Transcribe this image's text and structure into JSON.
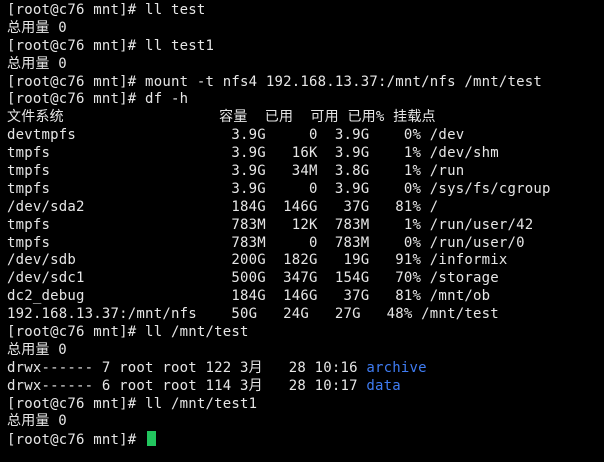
{
  "colors": {
    "background": "#000000",
    "text": "#e6e6e6",
    "directory": "#3f7cf3",
    "cursor": "#22c55e"
  },
  "terminal": {
    "lines": [
      "[root@c76 mnt]# ll test",
      "总用量 0",
      "[root@c76 mnt]# ll test1",
      "总用量 0",
      "[root@c76 mnt]# mount -t nfs4 192.168.13.37:/mnt/nfs /mnt/test",
      "[root@c76 mnt]# df -h",
      "文件系统                  容量  已用  可用 已用% 挂载点",
      "devtmpfs                  3.9G     0  3.9G    0% /dev",
      "tmpfs                     3.9G   16K  3.9G    1% /dev/shm",
      "tmpfs                     3.9G   34M  3.8G    1% /run",
      "tmpfs                     3.9G     0  3.9G    0% /sys/fs/cgroup",
      "/dev/sda2                 184G  146G   37G   81% /",
      "tmpfs                     783M   12K  783M    1% /run/user/42",
      "tmpfs                     783M     0  783M    0% /run/user/0",
      "/dev/sdb                  200G  182G   19G   91% /informix",
      "/dev/sdc1                 500G  347G  154G   70% /storage",
      "dc2_debug                 184G  146G   37G   81% /mnt/ob",
      "192.168.13.37:/mnt/nfs    50G   24G   27G   48% /mnt/test",
      "[root@c76 mnt]# ll /mnt/test",
      "总用量 0"
    ],
    "listing": [
      {
        "perms": "drwx------ 7 root root 122 3月   28 10:16 ",
        "name": "archive"
      },
      {
        "perms": "drwx------ 6 root root 114 3月   28 10:17 ",
        "name": "data"
      }
    ],
    "tail_lines": [
      "[root@c76 mnt]# ll /mnt/test1",
      "总用量 0"
    ],
    "prompt": "[root@c76 mnt]# "
  }
}
